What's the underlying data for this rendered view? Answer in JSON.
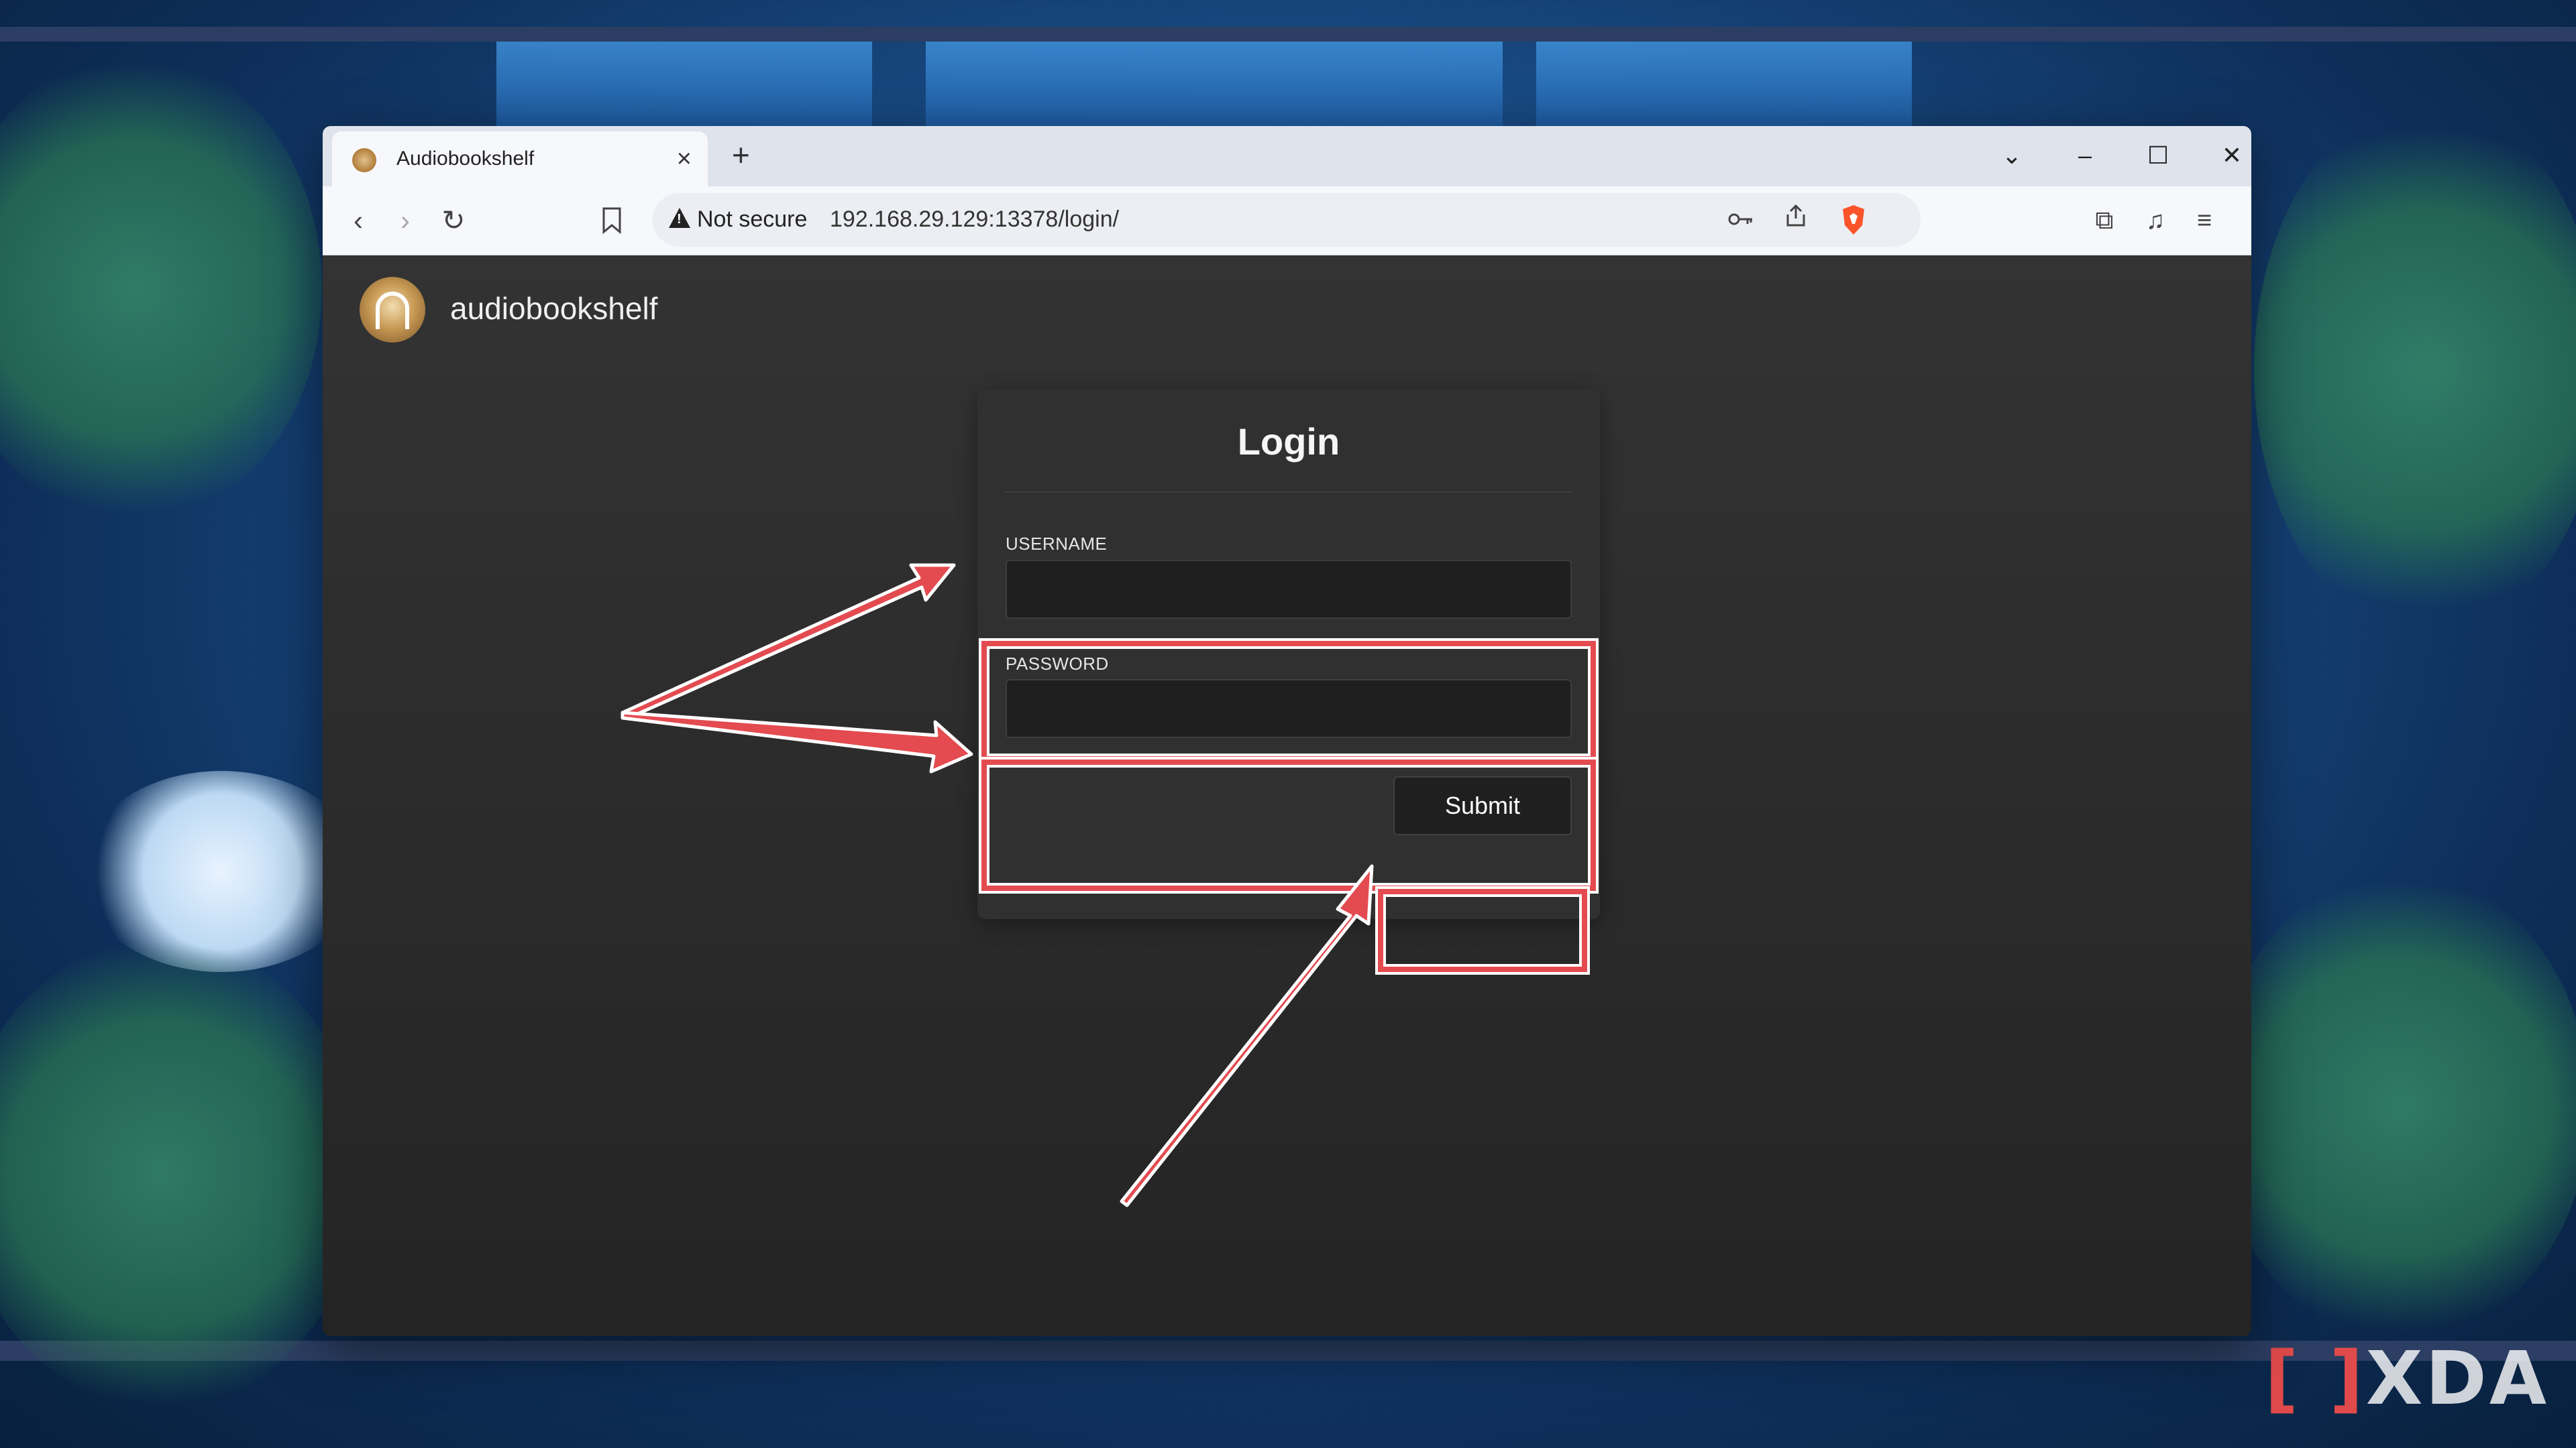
{
  "browser": {
    "tab_title": "Audiobookshelf",
    "tab_close": "×",
    "new_tab": "+",
    "security_label": "Not secure",
    "url": "192.168.29.129:13378/login/"
  },
  "app": {
    "name": "audiobookshelf"
  },
  "login": {
    "title": "Login",
    "username_label": "USERNAME",
    "username_value": "",
    "password_label": "PASSWORD",
    "password_value": "",
    "submit_label": "Submit"
  },
  "annotation": {
    "highlight_color": "#e34b50",
    "arrow_color": "#e34b50"
  },
  "watermark": {
    "text": "XDA"
  }
}
